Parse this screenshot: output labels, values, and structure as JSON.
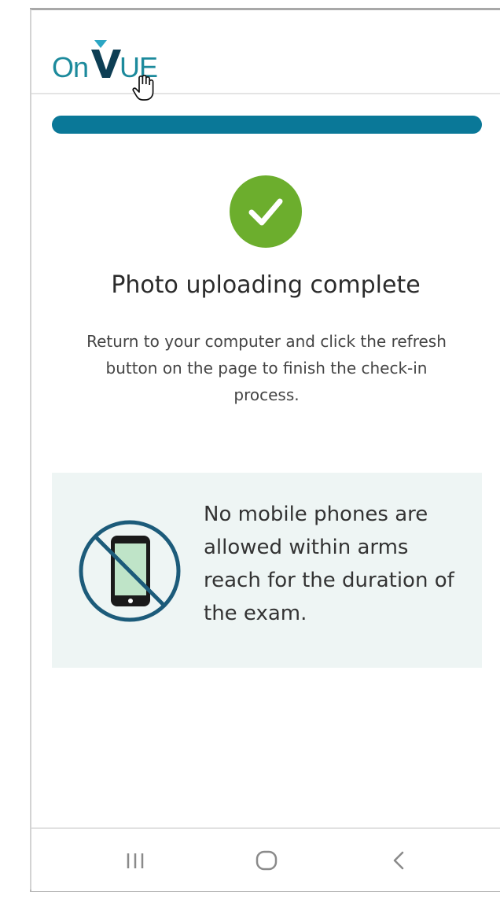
{
  "app": {
    "logo_text_on": "On",
    "logo_text_ue": "UE",
    "brand_color": "#1c8a9c",
    "logo_v_color": "#0d3e54",
    "logo_triangle_color": "#2ba6c4"
  },
  "progress": {
    "fraction": 1.0,
    "fill_color": "#0a7898"
  },
  "status": {
    "icon": "checkmark-icon",
    "icon_color": "#6cae2d",
    "title": "Photo uploading complete",
    "description": "Return to your computer and click the refresh button on the page to finish the check-in process."
  },
  "notice": {
    "icon": "no-phone-icon",
    "text": "No mobile phones are allowed within arms reach for the duration of the exam.",
    "background_color": "#eef5f4",
    "icon_stroke_color": "#1c5b7a",
    "phone_screen_color": "#bfe4c8"
  },
  "navbar": {
    "recent_icon": "recent-apps-icon",
    "home_icon": "home-icon",
    "back_icon": "back-icon"
  }
}
